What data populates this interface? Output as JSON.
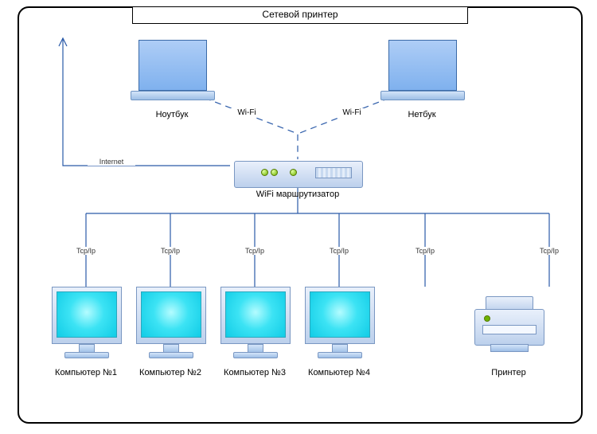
{
  "title": "Сетевой принтер",
  "devices": {
    "laptop": {
      "label": "Ноутбук"
    },
    "netbook": {
      "label": "Нетбук"
    },
    "router": {
      "label": "WiFi маршрутизатор"
    },
    "pc1": {
      "label": "Компьютер №1"
    },
    "pc2": {
      "label": "Компьютер №2"
    },
    "pc3": {
      "label": "Компьютер №3"
    },
    "pc4": {
      "label": "Компьютер №4"
    },
    "printer": {
      "label": "Принтер"
    }
  },
  "links": {
    "wifi": "Wi-Fi",
    "internet": "Internet",
    "tcpip": "Tcp/Ip"
  }
}
